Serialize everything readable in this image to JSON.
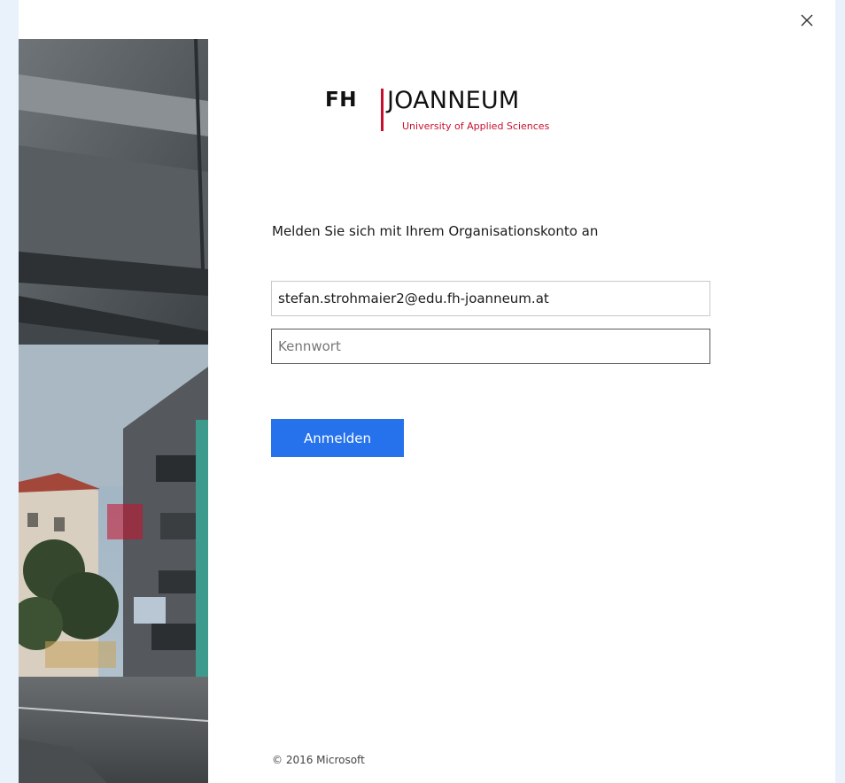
{
  "dialog": {
    "close_icon": "close-icon",
    "close_glyph": "✕"
  },
  "brand": {
    "short": "FH",
    "name": "JOANNEUM",
    "subtitle": "University of Applied Sciences",
    "accent_color": "#c8102e"
  },
  "login": {
    "heading": "Melden Sie sich mit Ihrem Organisationskonto an",
    "email_value": "stefan.strohmaier2@edu.fh-joanneum.at",
    "password_placeholder": "Kennwort",
    "submit_label": "Anmelden",
    "button_color": "#2672ec"
  },
  "footer": {
    "copyright": "© 2016 Microsoft"
  }
}
